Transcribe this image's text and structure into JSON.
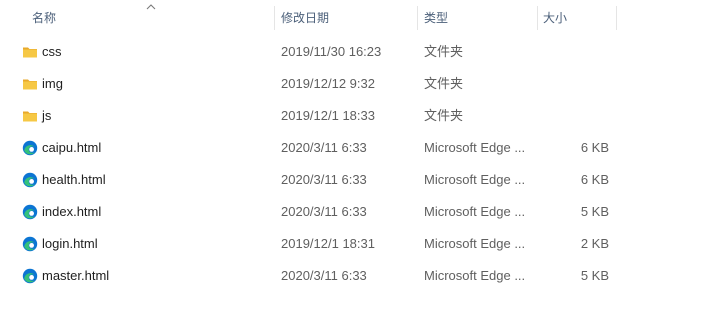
{
  "columns": {
    "name": "名称",
    "date": "修改日期",
    "type": "类型",
    "size": "大小"
  },
  "files": [
    {
      "name": "css",
      "date": "2019/11/30 16:23",
      "type": "文件夹",
      "size": "",
      "icon": "folder-icon"
    },
    {
      "name": "img",
      "date": "2019/12/12 9:32",
      "type": "文件夹",
      "size": "",
      "icon": "folder-icon"
    },
    {
      "name": "js",
      "date": "2019/12/1 18:33",
      "type": "文件夹",
      "size": "",
      "icon": "folder-icon"
    },
    {
      "name": "caipu.html",
      "date": "2020/3/11 6:33",
      "type": "Microsoft Edge ...",
      "size": "6 KB",
      "icon": "edge-icon"
    },
    {
      "name": "health.html",
      "date": "2020/3/11 6:33",
      "type": "Microsoft Edge ...",
      "size": "6 KB",
      "icon": "edge-icon"
    },
    {
      "name": "index.html",
      "date": "2020/3/11 6:33",
      "type": "Microsoft Edge ...",
      "size": "5 KB",
      "icon": "edge-icon"
    },
    {
      "name": "login.html",
      "date": "2019/12/1 18:31",
      "type": "Microsoft Edge ...",
      "size": "2 KB",
      "icon": "edge-icon"
    },
    {
      "name": "master.html",
      "date": "2020/3/11 6:33",
      "type": "Microsoft Edge ...",
      "size": "5 KB",
      "icon": "edge-icon"
    }
  ],
  "colors": {
    "folder": "#f6c845",
    "edge_blue": "#0c75d3",
    "edge_green": "#34c17b",
    "header_text": "#4c607a"
  }
}
